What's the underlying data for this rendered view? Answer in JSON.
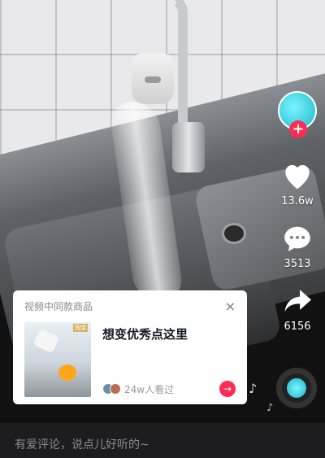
{
  "product_card": {
    "header": "视频中同款商品",
    "close_glyph": "×",
    "title": "想变优秀点这里",
    "thumb_label": "淘宝",
    "viewers": "24w人看过",
    "go_glyph": "→"
  },
  "sidebar": {
    "follow_glyph": "+",
    "like_count": "13.6w",
    "comment_count": "3513",
    "share_count": "6156"
  },
  "music": {
    "note_glyph": "♪"
  },
  "comment_bar": {
    "placeholder": "有爱评论，说点儿好听的~"
  },
  "colors": {
    "accent": "#fe2c55",
    "avatar": "#2ad0e0"
  },
  "icons": [
    "heart-icon",
    "comment-icon",
    "share-icon",
    "close-icon",
    "arrow-right-icon",
    "music-note-icon",
    "plus-icon"
  ]
}
